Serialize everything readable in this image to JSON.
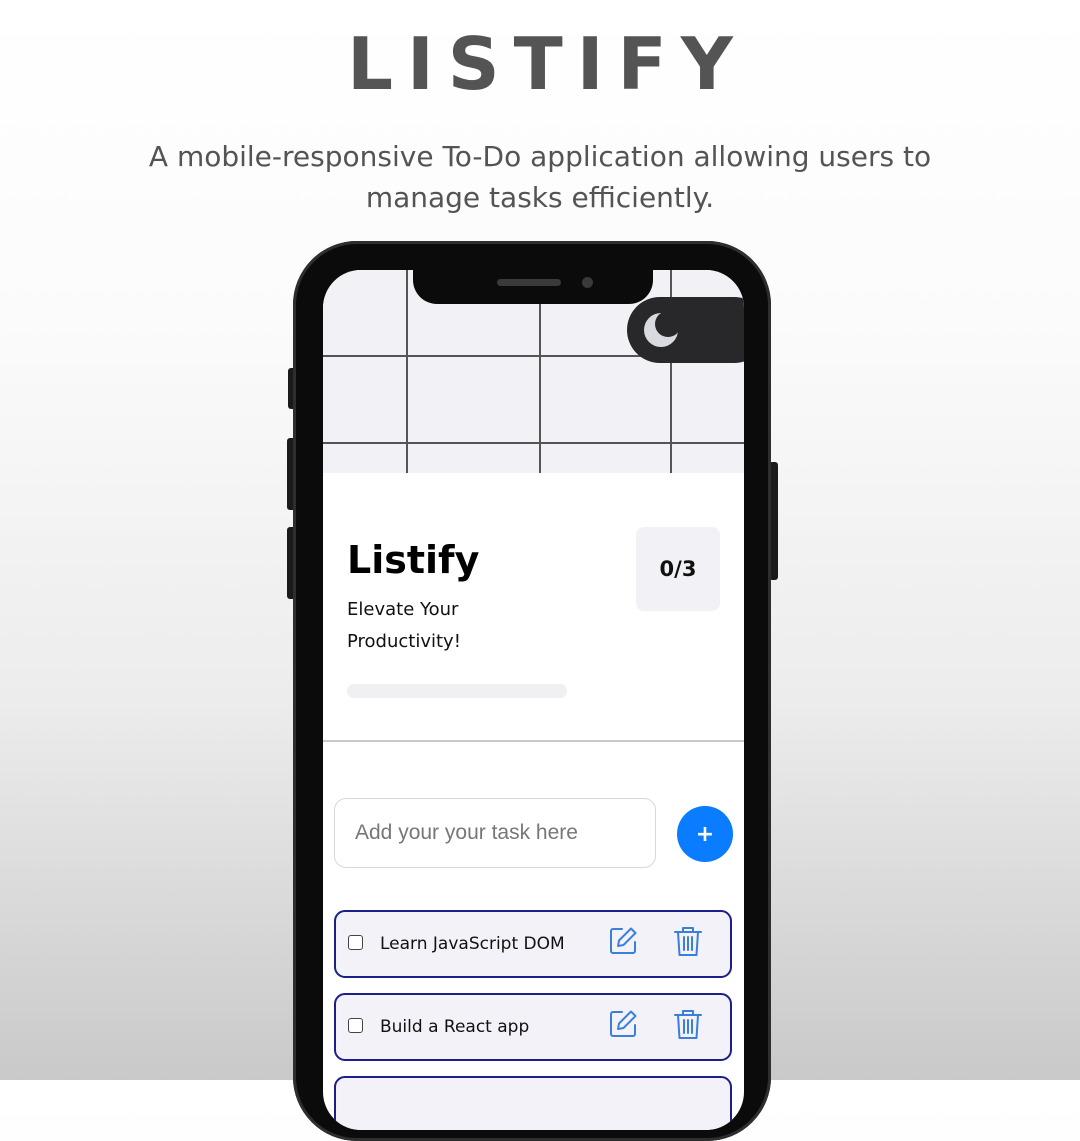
{
  "hero": {
    "title": "LISTIFY",
    "subtitle": "A mobile-responsive To-Do application allowing users to manage tasks efficiently."
  },
  "app": {
    "title": "Listify",
    "tagline": "Elevate Your Productivity!",
    "counter": "0/3",
    "progress": 0,
    "theme_toggle_icon": "moon-icon",
    "input_placeholder": "Add your your task here",
    "add_button_label": "+",
    "tasks": [
      {
        "text": "Learn JavaScript DOM",
        "completed": false
      },
      {
        "text": "Build a React app",
        "completed": false
      },
      {
        "text": "",
        "completed": false
      }
    ]
  },
  "colors": {
    "accent": "#0a7cff",
    "task_border": "#1b1f8a",
    "icon_blue": "#3b7fd9",
    "toggle_bg": "#28282b"
  }
}
